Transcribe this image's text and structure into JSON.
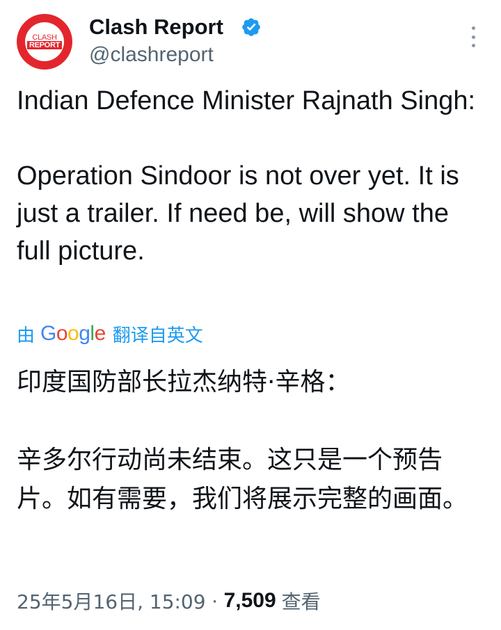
{
  "author": {
    "name": "Clash Report",
    "handle": "@clashreport",
    "verified": true,
    "avatar_logo_top": "CLASH",
    "avatar_logo_bottom": "REPORT"
  },
  "tweet": {
    "paragraph1": "Indian Defence Minister Rajnath Singh:",
    "paragraph2": "Operation Sindoor is not over yet. It is just a trailer. If need be, will show the full picture."
  },
  "translation": {
    "prefix": "由",
    "google_letters": [
      "G",
      "o",
      "o",
      "g",
      "l",
      "e"
    ],
    "google_colors": [
      "#4285f4",
      "#ea4335",
      "#fbbc05",
      "#4285f4",
      "#34a853",
      "#ea4335"
    ],
    "suffix": "翻译自英文",
    "paragraph1": "印度国防部长拉杰纳特·辛格：",
    "paragraph2": "辛多尔行动尚未结束。这只是一个预告片。如有需要，我们将展示完整的画面。"
  },
  "meta": {
    "date": "25年5月16日, 15:09",
    "separator": "·",
    "views_count": "7,509",
    "views_label": "查看"
  },
  "colors": {
    "accent": "#1d9bf0",
    "brand_red": "#e3262d",
    "secondary_text": "#536471",
    "primary_text": "#0f1419"
  },
  "icons": {
    "verified": "verified-badge-icon",
    "more": "more-vertical-icon"
  }
}
